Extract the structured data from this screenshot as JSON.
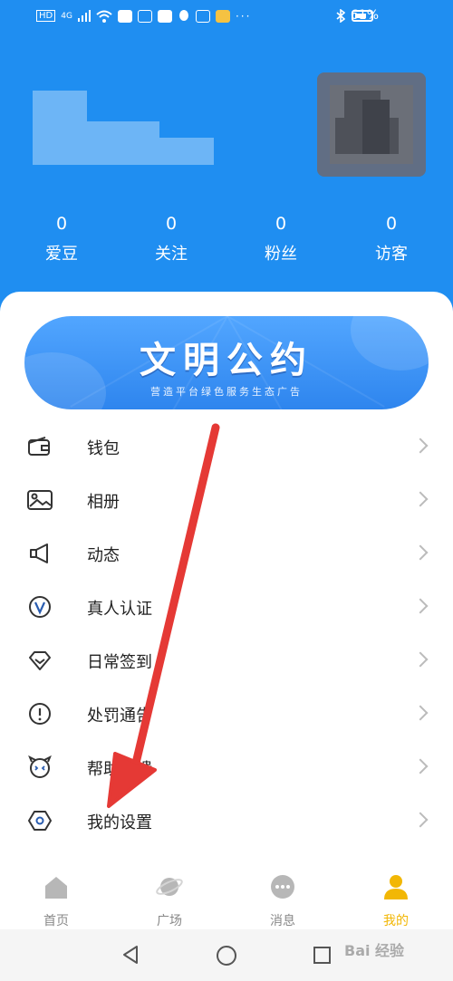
{
  "status_bar": {
    "battery_text": "61%",
    "network": "4G"
  },
  "profile": {
    "stats": [
      {
        "value": "0",
        "label": "爱豆"
      },
      {
        "value": "0",
        "label": "关注"
      },
      {
        "value": "0",
        "label": "粉丝"
      },
      {
        "value": "0",
        "label": "访客"
      }
    ]
  },
  "banner": {
    "title": "文明公约",
    "subtitle": "营造平台绿色服务生态广告"
  },
  "menu": [
    {
      "label": "钱包",
      "icon": "wallet-icon"
    },
    {
      "label": "相册",
      "icon": "photo-album-icon"
    },
    {
      "label": "动态",
      "icon": "megaphone-icon"
    },
    {
      "label": "真人认证",
      "icon": "verify-v-icon"
    },
    {
      "label": "日常签到",
      "icon": "diamond-icon"
    },
    {
      "label": "处罚通告",
      "icon": "alert-circle-icon"
    },
    {
      "label": "帮助反馈",
      "icon": "feedback-face-icon"
    },
    {
      "label": "我的设置",
      "icon": "settings-hexagon-icon"
    }
  ],
  "tabs": [
    {
      "label": "首页",
      "icon": "home-icon",
      "active": false
    },
    {
      "label": "广场",
      "icon": "planet-icon",
      "active": false
    },
    {
      "label": "消息",
      "icon": "message-icon",
      "active": false
    },
    {
      "label": "我的",
      "icon": "profile-icon",
      "active": true
    }
  ],
  "colors": {
    "header_blue": "#1f8ef1",
    "active_tab": "#f2b705",
    "annotation_arrow": "#e53935"
  },
  "watermark": "Bai 经验"
}
